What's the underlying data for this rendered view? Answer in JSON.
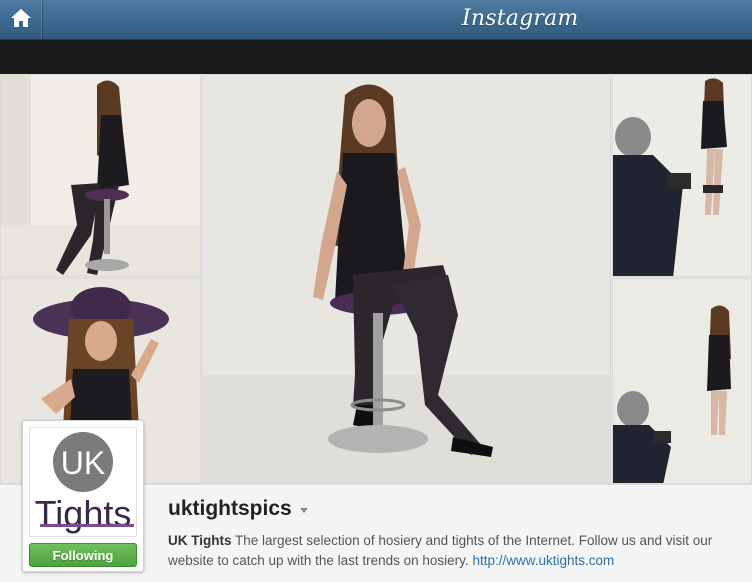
{
  "header": {
    "brand": "Instagram",
    "home_icon": "home-icon"
  },
  "photos": [
    {
      "id": "photo-1",
      "subject": "model seated on stool in patterned tights"
    },
    {
      "id": "photo-2",
      "subject": "model in wide brim hat"
    },
    {
      "id": "photo-3",
      "subject": "model seated on bar stool in fishnet tights"
    },
    {
      "id": "photo-4",
      "subject": "photographer shooting standing model"
    },
    {
      "id": "photo-5",
      "subject": "photographer shooting model"
    }
  ],
  "profile": {
    "avatar_text_top": "UK",
    "avatar_text_bottom": "Tights",
    "follow_label": "Following",
    "username": "uktightspics",
    "bio_name": "UK Tights",
    "bio_text": "The largest selection of hosiery and tights of the Internet. Follow us and visit our website to catch up with the last trends on hosiery.",
    "bio_link": "http://www.uktights.com"
  },
  "colors": {
    "topbar": "#3d6990",
    "follow_button": "#4fa43f",
    "link": "#2c6fa8"
  }
}
